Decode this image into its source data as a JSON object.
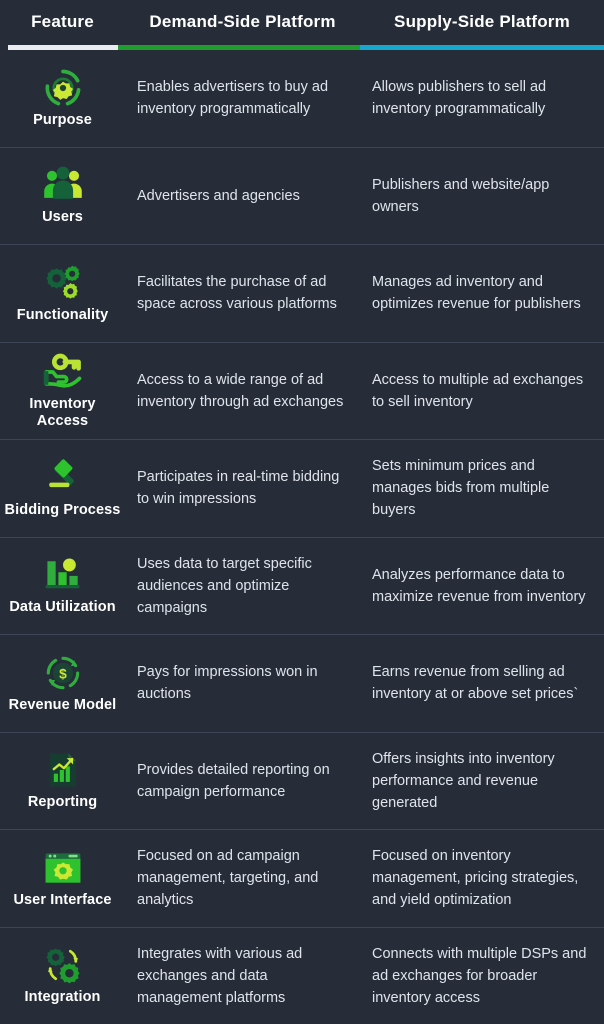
{
  "header": {
    "feature_label": "Feature",
    "demand_label": "Demand-Side Platform",
    "supply_label": "Supply-Side Platform",
    "rule_colors": {
      "feature": "#e9edf0",
      "demand": "#1f9d2e",
      "supply": "#17a7cd"
    }
  },
  "theme": {
    "background": "#262d38",
    "divider": "#3d4654",
    "heading_text": "#ffffff",
    "body_text": "#dfe4ea",
    "icon_green_bright": "#2fc22f",
    "icon_green_dark": "#1c6b3a",
    "icon_yellow_green": "#c8e832"
  },
  "rows": [
    {
      "icon": "target-gear-icon",
      "feature": "Purpose",
      "demand": "Enables advertisers to buy ad inventory programmatically",
      "supply": "Allows publishers to sell ad inventory programmatically"
    },
    {
      "icon": "users-group-icon",
      "feature": "Users",
      "demand": "Advertisers and agencies",
      "supply": "Publishers and website/app owners"
    },
    {
      "icon": "gears-icon",
      "feature": "Functionality",
      "demand": "Facilitates the purchase of ad space across various platforms",
      "supply": "Manages ad inventory and optimizes revenue for publishers"
    },
    {
      "icon": "hand-key-icon",
      "feature": "Inventory Access",
      "demand": "Access to a wide range of ad inventory through ad exchanges",
      "supply": "Access to multiple ad exchanges to sell inventory"
    },
    {
      "icon": "gavel-icon",
      "feature": "Bidding Process",
      "demand": "Participates in real-time bidding to win impressions",
      "supply": "Sets minimum prices and manages bids from multiple buyers"
    },
    {
      "icon": "bar-chart-person-icon",
      "feature": "Data Utilization",
      "demand": "Uses data to target specific audiences and optimize campaigns",
      "supply": "Analyzes performance data to maximize revenue from inventory"
    },
    {
      "icon": "dollar-cycle-icon",
      "feature": "Revenue Model",
      "demand": "Pays for impressions won in auctions",
      "supply": "Earns revenue from selling ad inventory at or above set prices`"
    },
    {
      "icon": "report-document-icon",
      "feature": "Reporting",
      "demand": "Provides detailed reporting on campaign performance",
      "supply": "Offers insights into inventory performance and revenue generated"
    },
    {
      "icon": "browser-gear-icon",
      "feature": "User Interface",
      "demand": "Focused on ad campaign management, targeting, and analytics",
      "supply": "Focused on inventory management, pricing strategies, and yield optimization"
    },
    {
      "icon": "gears-sync-icon",
      "feature": "Integration",
      "demand": "Integrates with various ad exchanges and data management platforms",
      "supply": "Connects with multiple DSPs and ad exchanges for broader inventory access"
    }
  ]
}
